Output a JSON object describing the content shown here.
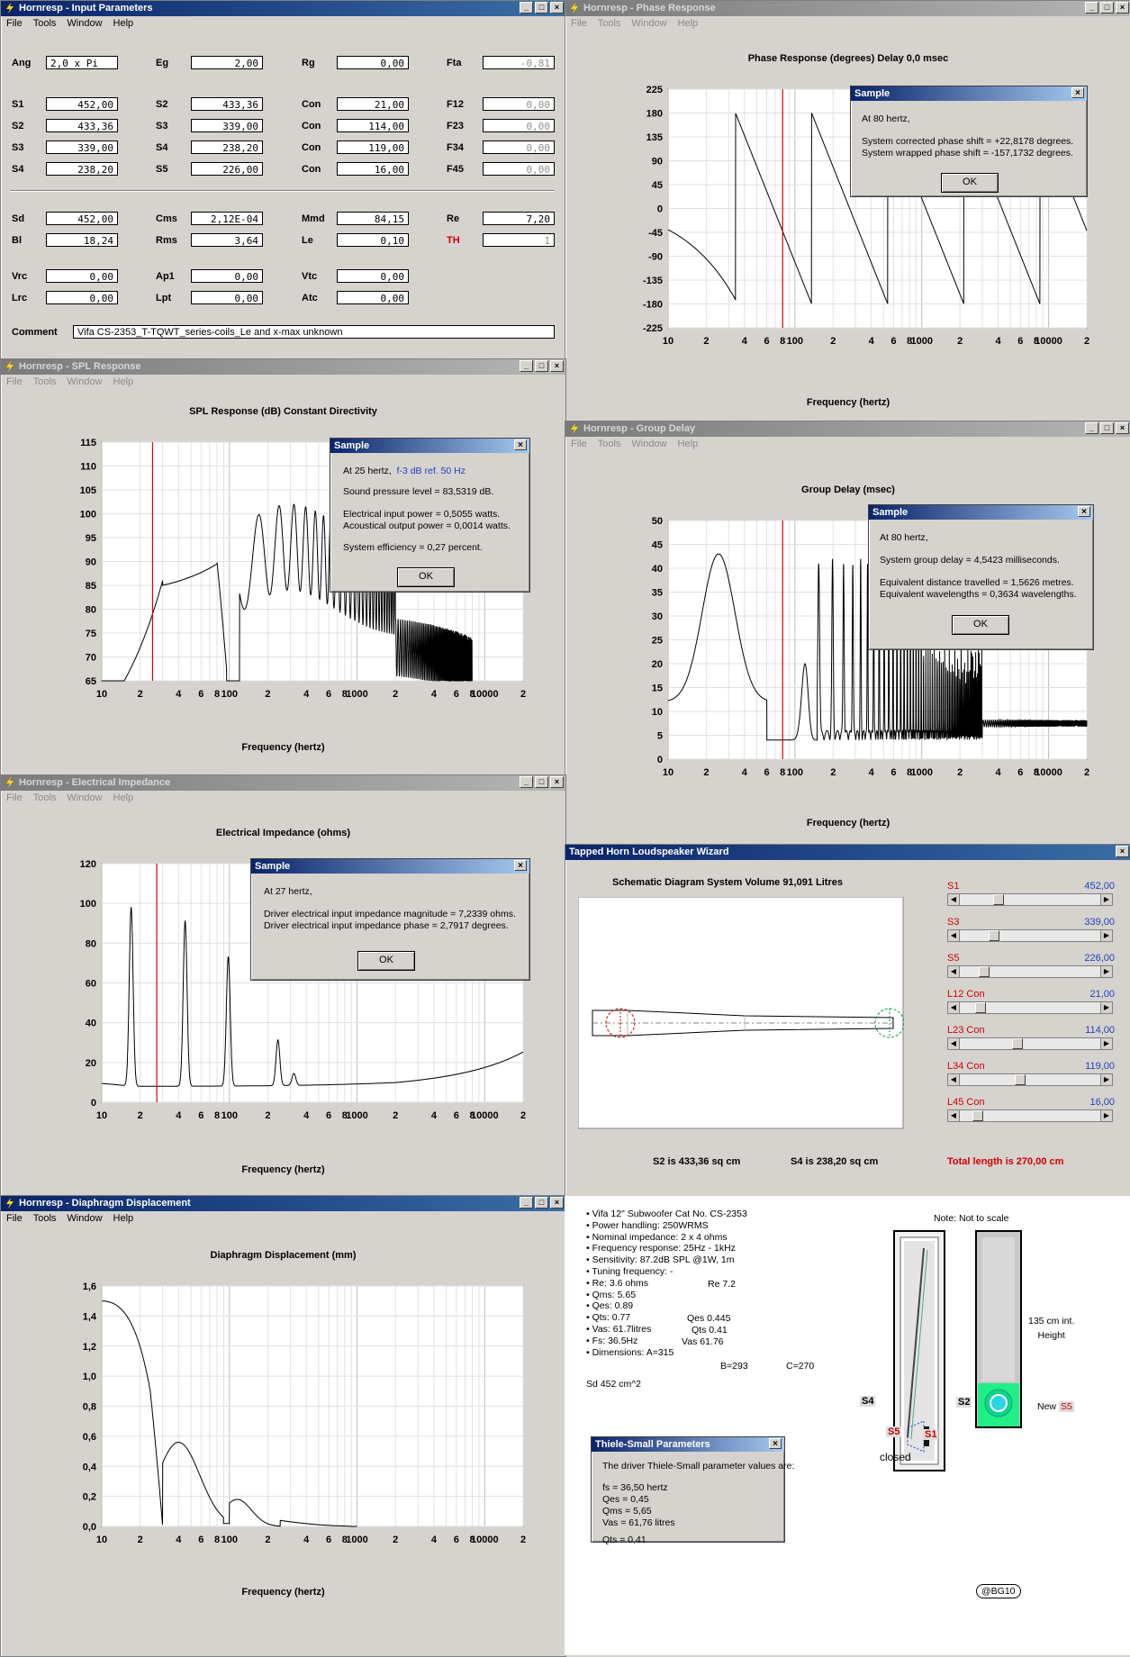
{
  "menu": {
    "file": "File",
    "tools": "Tools",
    "window": "Window",
    "help": "Help"
  },
  "titlebar_buttons": {
    "min": "_",
    "max": "□",
    "close": "×"
  },
  "input_params": {
    "title": "Hornresp - Input Parameters",
    "row1": {
      "ang_label": "Ang",
      "ang": "2,0 x Pi",
      "eg_label": "Eg",
      "eg": "2,00",
      "rg_label": "Rg",
      "rg": "0,00",
      "fta_label": "Fta",
      "fta": "-0,81"
    },
    "rows": [
      {
        "s_label": "S1",
        "s": "452,00",
        "s2_label": "S2",
        "s2": "433,36",
        "con_label": "Con",
        "con": "21,00",
        "f_label": "F12",
        "f": "0,00"
      },
      {
        "s_label": "S2",
        "s": "433,36",
        "s2_label": "S3",
        "s2": "339,00",
        "con_label": "Con",
        "con": "114,00",
        "f_label": "F23",
        "f": "0,00"
      },
      {
        "s_label": "S3",
        "s": "339,00",
        "s2_label": "S4",
        "s2": "238,20",
        "con_label": "Con",
        "con": "119,00",
        "f_label": "F34",
        "f": "0,00"
      },
      {
        "s_label": "S4",
        "s": "238,20",
        "s2_label": "S5",
        "s2": "226,00",
        "con_label": "Con",
        "con": "16,00",
        "f_label": "F45",
        "f": "0,00"
      }
    ],
    "driver": {
      "sd_label": "Sd",
      "sd": "452,00",
      "cms_label": "Cms",
      "cms": "2,12E-04",
      "mmd_label": "Mmd",
      "mmd": "84,15",
      "re_label": "Re",
      "re": "7,20",
      "bl_label": "Bl",
      "bl": "18,24",
      "rms_label": "Rms",
      "rms": "3,64",
      "le_label": "Le",
      "le": "0,10",
      "th_label": "TH",
      "th": "1"
    },
    "chambers": {
      "vrc_label": "Vrc",
      "vrc": "0,00",
      "ap1_label": "Ap1",
      "ap1": "0,00",
      "vtc_label": "Vtc",
      "vtc": "0,00",
      "lrc_label": "Lrc",
      "lrc": "0,00",
      "lpt_label": "Lpt",
      "lpt": "0,00",
      "atc_label": "Atc",
      "atc": "0,00"
    },
    "comment_label": "Comment",
    "comment": "Vifa CS-2353_T-TQWT_series-coils_Le and x-max unknown"
  },
  "phase": {
    "title": "Hornresp - Phase Response",
    "chart_title": "Phase Response (degrees)   Delay 0,0 msec",
    "xlabel": "Frequency (hertz)",
    "yticks": [
      "225",
      "180",
      "135",
      "90",
      "45",
      "0",
      "-45",
      "-90",
      "-135",
      "-180",
      "-225"
    ],
    "dialog": {
      "title": "Sample",
      "l1": "At 80 hertz,",
      "l2": "System corrected phase shift = +22,8178 degrees.",
      "l3": "System wrapped phase shift = -157,1732 degrees.",
      "ok": "OK"
    }
  },
  "spl": {
    "title": "Hornresp - SPL Response",
    "chart_title": "SPL Response (dB)   Constant Directivity",
    "xlabel": "Frequency (hertz)",
    "yticks": [
      "115",
      "110",
      "105",
      "100",
      "95",
      "90",
      "85",
      "80",
      "75",
      "70",
      "65"
    ],
    "dialog": {
      "title": "Sample",
      "l1": "At 25 hertz,",
      "l1b": "f-3 dB ref. 50 Hz",
      "l2": "Sound pressure level = 83,5319 dB.",
      "l3": "Electrical input power = 0,5055 watts.",
      "l4": "Acoustical output power = 0,0014 watts.",
      "l5": "System efficiency = 0,27 percent.",
      "ok": "OK"
    }
  },
  "group_delay": {
    "title": "Hornresp - Group Delay",
    "chart_title": "Group Delay (msec)",
    "xlabel": "Frequency (hertz)",
    "yticks": [
      "50",
      "45",
      "40",
      "35",
      "30",
      "25",
      "20",
      "15",
      "10",
      "5",
      "0"
    ],
    "dialog": {
      "title": "Sample",
      "l1": "At 80 hertz,",
      "l2": "System group delay = 4,5423 milliseconds.",
      "l3": "Equivalent distance travelled = 1,5626 metres.",
      "l4": "Equivalent wavelengths = 0,3634 wavelengths.",
      "ok": "OK"
    }
  },
  "impedance": {
    "title": "Hornresp - Electrical Impedance",
    "chart_title": "Electrical Impedance (ohms)",
    "xlabel": "Frequency (hertz)",
    "yticks": [
      "120",
      "100",
      "80",
      "60",
      "40",
      "20",
      "0"
    ],
    "dialog": {
      "title": "Sample",
      "l1": "At 27 hertz,",
      "l2": "Driver electrical input impedance magnitude = 7,2339 ohms.",
      "l3": "Driver electrical input impedance phase = 2,7917 degrees.",
      "ok": "OK"
    }
  },
  "displacement": {
    "title": "Hornresp - Diaphragm Displacement",
    "chart_title": "Diaphragm Displacement (mm)",
    "xlabel": "Frequency (hertz)",
    "yticks": [
      "1,6",
      "1,4",
      "1,2",
      "1,0",
      "0,8",
      "0,6",
      "0,4",
      "0,2",
      "0,0"
    ]
  },
  "xticks": [
    "10",
    "2",
    "4",
    "6",
    "8",
    "100",
    "2",
    "4",
    "6",
    "8",
    "1000",
    "2",
    "4",
    "6",
    "8",
    "10000",
    "2"
  ],
  "wizard": {
    "title": "Tapped Horn Loudspeaker Wizard",
    "schematic_title": "Schematic Diagram    System Volume 91,091 Litres",
    "sliders": [
      {
        "label": "S1",
        "value": "452,00"
      },
      {
        "label": "S3",
        "value": "339,00"
      },
      {
        "label": "S5",
        "value": "226,00"
      },
      {
        "label": "L12  Con",
        "value": "21,00"
      },
      {
        "label": "L23  Con",
        "value": "114,00"
      },
      {
        "label": "L34  Con",
        "value": "119,00"
      },
      {
        "label": "L45  Con",
        "value": "16,00"
      }
    ],
    "s2_info": "S2 is 433,36 sq cm",
    "s4_info": "S4 is 238,20 sq cm",
    "total_length": "Total length is 270,00 cm"
  },
  "specs": {
    "lines": [
      "• Vifa 12\" Subwoofer Cat No. CS-2353",
      "• Power handling: 250WRMS",
      "• Nominal impedance: 2 x 4 ohms",
      "• Frequency response: 25Hz - 1kHz",
      "• Sensitivity: 87.2dB SPL @1W, 1m",
      "• Tuning frequency: -",
      "• Re: 3.6 ohms",
      "• Qms: 5.65",
      "• Qes: 0.89",
      "• Qts: 0.77",
      "• Vas: 61.7litres",
      "• Fs: 36.5Hz",
      "• Dimensions: A=315"
    ],
    "re_right": "Re   7.2",
    "qes_right": "Qes   0.445",
    "qts_right": "Qts   0.41",
    "vas_right": "Vas     61.76",
    "dim_b": "B=293",
    "dim_c": "C=270",
    "sd": "Sd 452 cm^2"
  },
  "drawing": {
    "note": "Note: Not to scale",
    "height_label": "135 cm int.\nHeight",
    "height_l1": "135 cm int.",
    "height_l2": "Height",
    "s4": "S4",
    "s2": "S2",
    "s5": "S5",
    "s1": "S1",
    "closed": "closed",
    "new": "New",
    "new_s5": "S5",
    "signature": "@BG10"
  },
  "ts_params": {
    "title": "Thiele-Small Parameters",
    "intro": "The driver Thiele-Small parameter values are:",
    "fs": "fs = 36,50 hertz",
    "qes": "Qes = 0,45",
    "qms": "Qms = 5,65",
    "vas": "Vas = 61,76 litres",
    "qts": "Qts = 0,41"
  },
  "colors": {
    "accent": "#0a246a",
    "red": "#d00000",
    "blue": "#2040c0",
    "green": "#00e070"
  }
}
